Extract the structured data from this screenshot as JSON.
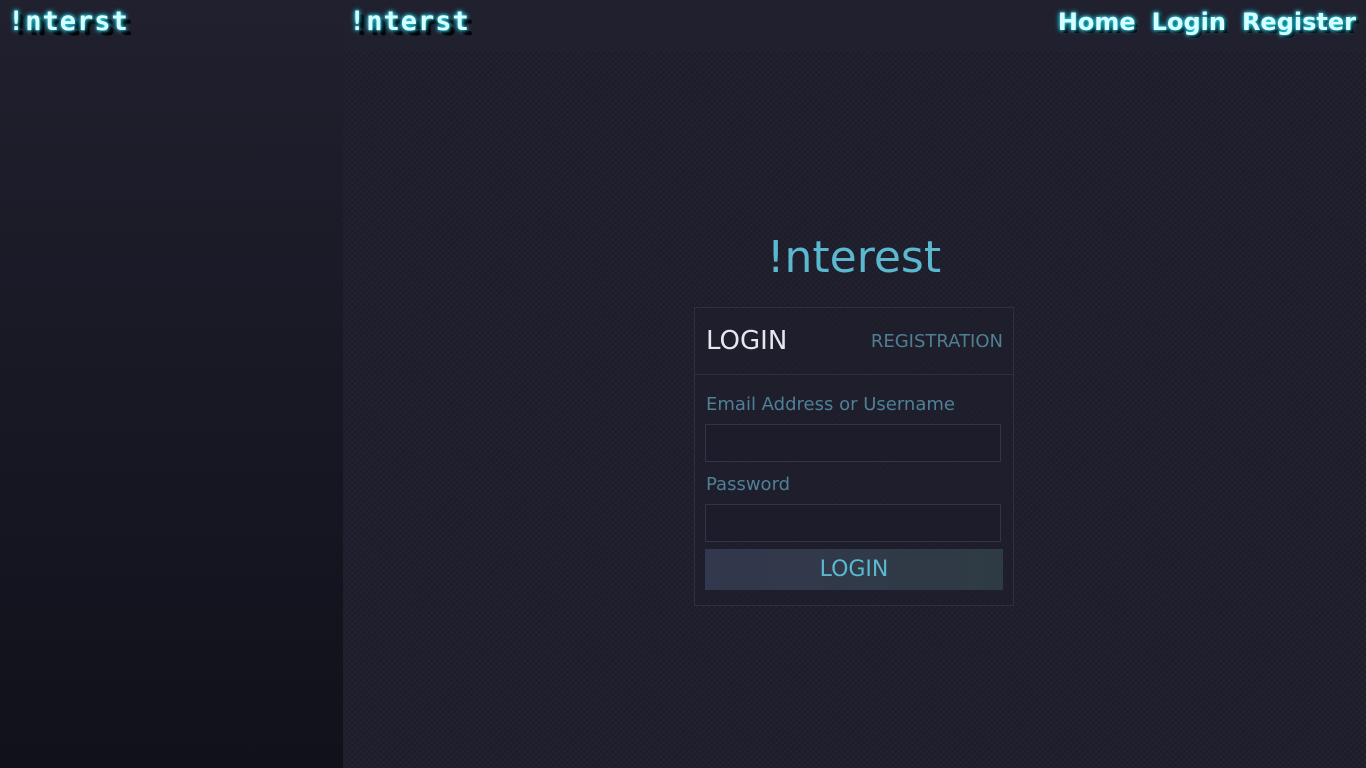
{
  "sidebar": {
    "logo_text": "!nterst"
  },
  "header": {
    "logo_text": "!nterst",
    "nav": [
      {
        "label": "Home"
      },
      {
        "label": "Login"
      },
      {
        "label": "Register"
      }
    ]
  },
  "main": {
    "brand_title": "!nterest",
    "tabs": {
      "login": "LOGIN",
      "registration": "REGISTRATION"
    },
    "form": {
      "email_label": "Email Address or Username",
      "email_value": "",
      "password_label": "Password",
      "password_value": "",
      "submit_label": "LOGIN"
    }
  },
  "colors": {
    "accent": "#5bb8cf",
    "glow": "#25d6f0",
    "background": "#1f1f2d"
  }
}
